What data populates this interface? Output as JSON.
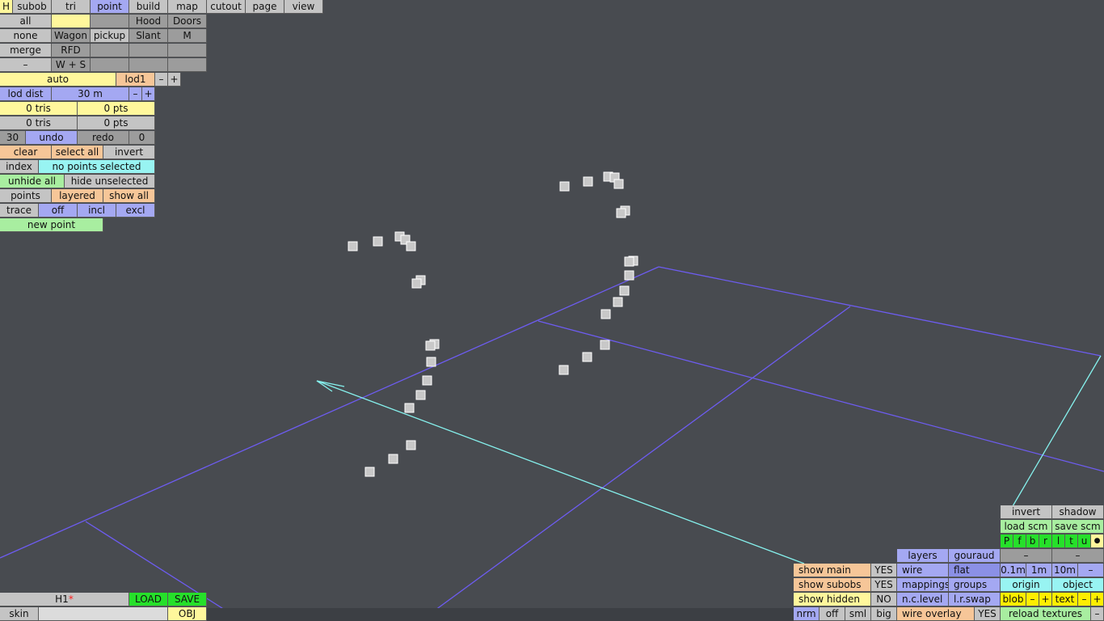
{
  "colors": {
    "background": "#484b50",
    "grid_line": "#6d5cf0",
    "axis_line": "#86f2ee",
    "point_fill": "#c8c8c8"
  },
  "top_menu": {
    "h": "H",
    "tabs": [
      "subob",
      "tri",
      "point",
      "build",
      "map",
      "cutout",
      "page",
      "view"
    ],
    "active_tab": "point"
  },
  "left_grid": {
    "row1": {
      "all": "all",
      "hood": "Hood",
      "doors": "Doors"
    },
    "row2": {
      "none": "none",
      "wagon": "Wagon",
      "pickup": "pickup",
      "slant": "Slant",
      "m": "M"
    },
    "row3": {
      "merge": "merge",
      "rfd": "RFD"
    },
    "row4": {
      "minus": "–",
      "ws": "W + S"
    }
  },
  "lod": {
    "auto": "auto",
    "lod1": "lod1",
    "minus": "–",
    "plus": "+",
    "dist_label": "lod dist",
    "dist_value": "30 m",
    "dist_minus": "–",
    "dist_plus": "+"
  },
  "counts": {
    "tris_sel": "0 tris",
    "pts_sel": "0 pts",
    "tris_total": "0 tris",
    "pts_total": "0 pts"
  },
  "history": {
    "undo_count": "30",
    "undo": "undo",
    "redo": "redo",
    "redo_count": "0"
  },
  "selection": {
    "clear": "clear",
    "select_all": "select all",
    "invert": "invert"
  },
  "index": {
    "label": "index",
    "status": "no points selected"
  },
  "visibility": {
    "unhide_all": "unhide all",
    "hide_unselected": "hide unselected"
  },
  "points_row": {
    "points": "points",
    "layered": "layered",
    "show_all": "show all"
  },
  "trace": {
    "label": "trace",
    "off": "off",
    "incl": "incl",
    "excl": "excl"
  },
  "new_point": "new point",
  "bottom_left": {
    "file_name": "H1",
    "modified_mark": "*",
    "load": "LOAD",
    "save": "SAVE",
    "skin": "skin",
    "obj": "OBJ"
  },
  "bottom_right": {
    "invert": "invert",
    "shadow": "shadow",
    "load_scm": "load scm",
    "save_scm": "save scm",
    "flags": [
      "P",
      "f",
      "b",
      "r",
      "l",
      "t",
      "u"
    ],
    "dot": "●",
    "dash1": "–",
    "dash2": "–",
    "layers": "layers",
    "gouraud": "gouraud",
    "show_main": "show main",
    "show_main_val": "YES",
    "wire": "wire",
    "flat": "flat",
    "grid_01": "0.1m",
    "grid_1": "1m",
    "grid_10": "10m",
    "grid_minus": "–",
    "show_subobs": "show subobs",
    "show_subobs_val": "YES",
    "mappings": "mappings",
    "groups": "groups",
    "origin": "origin",
    "object": "object",
    "show_hidden": "show hidden",
    "show_hidden_val": "NO",
    "nc_level": "n.c.level",
    "lr_swap": "l.r.swap",
    "blob": "blob",
    "blob_minus": "–",
    "blob_plus": "+",
    "text": "text",
    "text_minus": "–",
    "text_plus": "+",
    "nrm": "nrm",
    "off": "off",
    "sml": "sml",
    "big": "big",
    "wire_overlay": "wire overlay",
    "wire_overlay_val": "YES",
    "reload_textures": "reload textures",
    "reload_minus": "–"
  }
}
